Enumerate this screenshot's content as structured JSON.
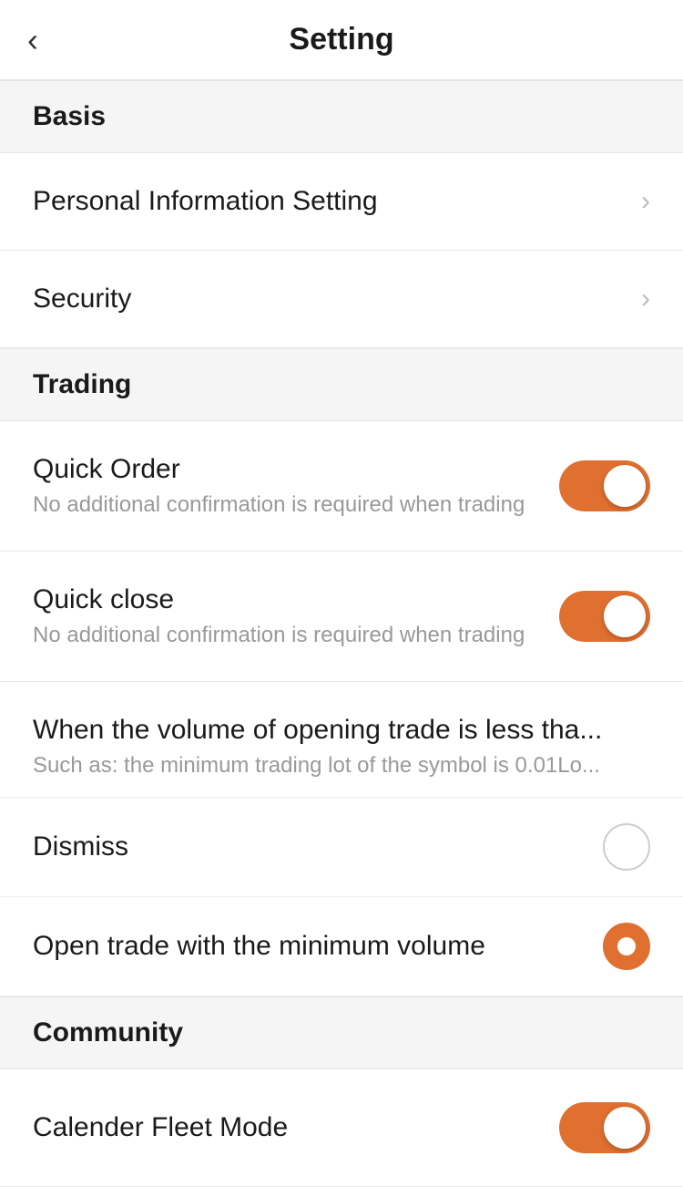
{
  "header": {
    "title": "Setting",
    "back_icon": "‹"
  },
  "sections": [
    {
      "id": "basis",
      "label": "Basis",
      "items": [
        {
          "id": "personal-info",
          "title": "Personal Information Setting",
          "type": "nav"
        },
        {
          "id": "security",
          "title": "Security",
          "type": "nav"
        }
      ]
    },
    {
      "id": "trading",
      "label": "Trading",
      "items": [
        {
          "id": "quick-order",
          "title": "Quick Order",
          "subtitle": "No additional confirmation is required when trading",
          "type": "toggle",
          "value": true
        },
        {
          "id": "quick-close",
          "title": "Quick close",
          "subtitle": "No additional confirmation is required when trading",
          "type": "toggle",
          "value": true
        }
      ]
    }
  ],
  "volume_section": {
    "title": "When the volume of opening trade is less tha...",
    "subtitle": "Such as: the minimum trading lot of the symbol is 0.01Lo...",
    "options": [
      {
        "id": "dismiss",
        "label": "Dismiss",
        "selected": false
      },
      {
        "id": "open-min-volume",
        "label": "Open trade with the minimum volume",
        "selected": true
      }
    ]
  },
  "community_section": {
    "label": "Community",
    "items": [
      {
        "id": "calendar-fleet-mode",
        "title": "Calender Fleet Mode",
        "type": "toggle",
        "value": true
      }
    ]
  },
  "colors": {
    "accent": "#e07030",
    "section_bg": "#f5f5f5",
    "divider": "#e8e8e8",
    "text_primary": "#1a1a1a",
    "text_secondary": "#999999"
  }
}
